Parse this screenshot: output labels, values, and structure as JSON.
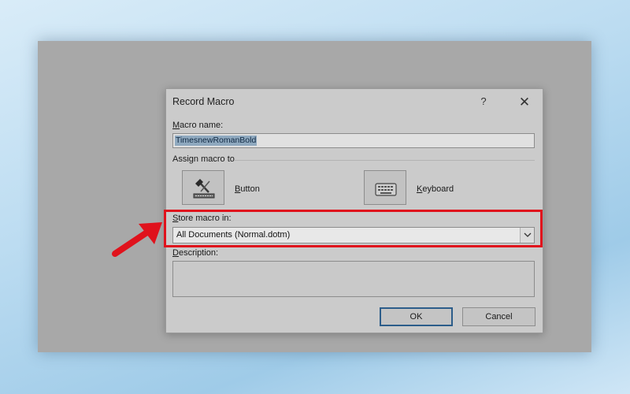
{
  "dialog": {
    "title": "Record Macro",
    "help_symbol": "?",
    "close_symbol": "✕",
    "macro_name_label_accel": "M",
    "macro_name_label_rest": "acro name:",
    "macro_name_value": "TimesnewRomanBold",
    "assign_label": "Assign macro to",
    "button_label_accel": "B",
    "button_label_rest": "utton",
    "keyboard_label_accel": "K",
    "keyboard_label_rest": "eyboard",
    "store_label_accel": "S",
    "store_label_rest": "tore macro in:",
    "store_value": "All Documents (Normal.dotm)",
    "description_label_accel": "D",
    "description_label_rest": "escription:",
    "description_value": "",
    "ok_label": "OK",
    "cancel_label": "Cancel"
  },
  "icons": {
    "button_icon": "hammer-toolbar-icon",
    "keyboard_icon": "keyboard-icon",
    "dropdown_icon": "chevron-down-icon",
    "annotation": "red-arrow-pointer"
  },
  "colors": {
    "highlight": "#e0121c",
    "selection": "#8fa9bf",
    "ok_border": "#2c5d8a"
  }
}
